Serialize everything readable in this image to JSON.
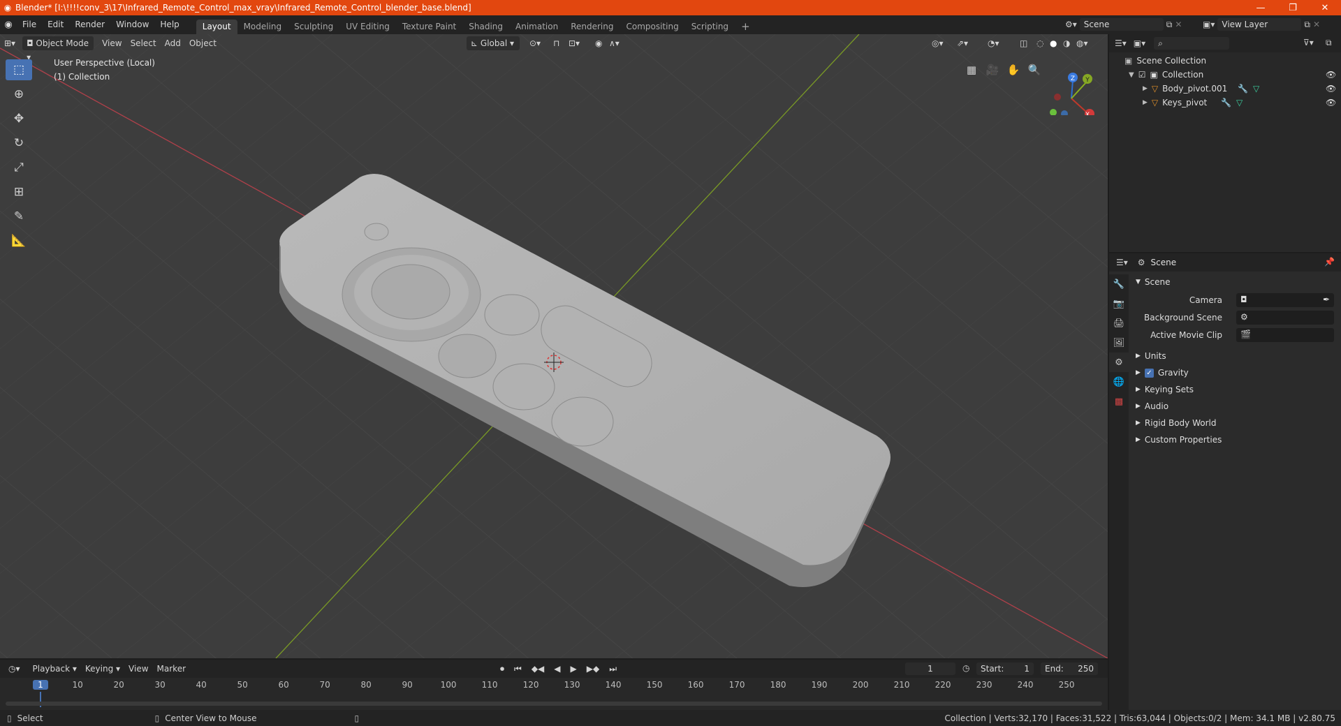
{
  "window": {
    "title": "Blender* [I:\\!!!!conv_3\\17\\Infrared_Remote_Control_max_vray\\Infrared_Remote_Control_blender_base.blend]",
    "minimize": "—",
    "maximize": "❐",
    "close": "✕"
  },
  "menus": [
    "File",
    "Edit",
    "Render",
    "Window",
    "Help"
  ],
  "workspaces": [
    "Layout",
    "Modeling",
    "Sculpting",
    "UV Editing",
    "Texture Paint",
    "Shading",
    "Animation",
    "Rendering",
    "Compositing",
    "Scripting"
  ],
  "active_workspace": "Layout",
  "add_workspace": "+",
  "scene_selector": "Scene",
  "view_layer_selector": "View Layer",
  "viewport": {
    "mode": "Object Mode",
    "menu": [
      "View",
      "Select",
      "Add",
      "Object"
    ],
    "transform_orientation": "Global",
    "info_line1": "User Perspective (Local)",
    "info_line2": "(1) Collection",
    "gizmo": {
      "x": "X",
      "y": "Y",
      "z": "Z"
    }
  },
  "outliner": {
    "search_placeholder": "",
    "root": "Scene Collection",
    "collection": "Collection",
    "items": [
      "Body_pivot.001",
      "Keys_pivot"
    ]
  },
  "properties": {
    "header": "Scene",
    "section": "Scene",
    "camera_label": "Camera",
    "background_scene_label": "Background Scene",
    "active_movie_clip_label": "Active Movie Clip",
    "subsections": [
      "Units",
      "Gravity",
      "Keying Sets",
      "Audio",
      "Rigid Body World",
      "Custom Properties"
    ]
  },
  "timeline": {
    "menu": [
      "Playback",
      "Keying",
      "View",
      "Marker"
    ],
    "current_frame": "1",
    "start_label": "Start:",
    "start": "1",
    "end_label": "End:",
    "end": "250",
    "ruler": [
      "1",
      "10",
      "20",
      "30",
      "40",
      "50",
      "60",
      "70",
      "80",
      "90",
      "100",
      "110",
      "120",
      "130",
      "140",
      "150",
      "160",
      "170",
      "180",
      "190",
      "200",
      "210",
      "220",
      "230",
      "240",
      "250"
    ]
  },
  "statusbar": {
    "left_action": "Select",
    "mid_action": "Center View to Mouse",
    "stats": "Collection | Verts:32,170 | Faces:31,522 | Tris:63,044 | Objects:0/2 | Mem: 34.1 MB | v2.80.75"
  },
  "colors": {
    "title_bar": "#e2470f",
    "accent": "#4772b3",
    "viewport_bg": "#3d3d3d",
    "x_axis": "#c0392b",
    "y_axis": "#8ab020"
  }
}
